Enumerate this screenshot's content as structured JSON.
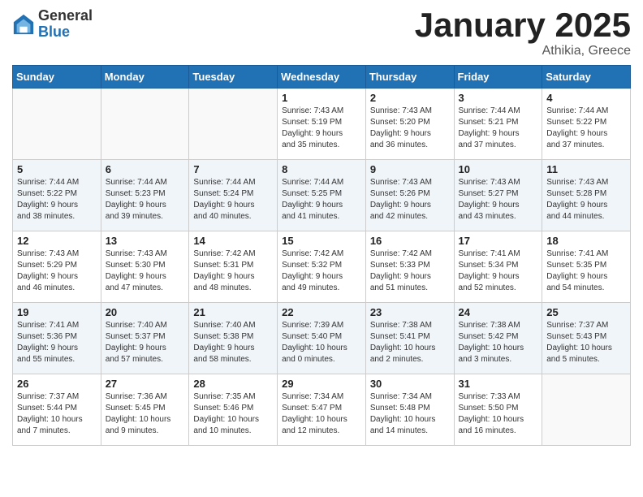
{
  "logo": {
    "general": "General",
    "blue": "Blue"
  },
  "header": {
    "title": "January 2025",
    "subtitle": "Athikia, Greece"
  },
  "weekdays": [
    "Sunday",
    "Monday",
    "Tuesday",
    "Wednesday",
    "Thursday",
    "Friday",
    "Saturday"
  ],
  "weeks": [
    [
      {
        "day": "",
        "info": ""
      },
      {
        "day": "",
        "info": ""
      },
      {
        "day": "",
        "info": ""
      },
      {
        "day": "1",
        "info": "Sunrise: 7:43 AM\nSunset: 5:19 PM\nDaylight: 9 hours\nand 35 minutes."
      },
      {
        "day": "2",
        "info": "Sunrise: 7:43 AM\nSunset: 5:20 PM\nDaylight: 9 hours\nand 36 minutes."
      },
      {
        "day": "3",
        "info": "Sunrise: 7:44 AM\nSunset: 5:21 PM\nDaylight: 9 hours\nand 37 minutes."
      },
      {
        "day": "4",
        "info": "Sunrise: 7:44 AM\nSunset: 5:22 PM\nDaylight: 9 hours\nand 37 minutes."
      }
    ],
    [
      {
        "day": "5",
        "info": "Sunrise: 7:44 AM\nSunset: 5:22 PM\nDaylight: 9 hours\nand 38 minutes."
      },
      {
        "day": "6",
        "info": "Sunrise: 7:44 AM\nSunset: 5:23 PM\nDaylight: 9 hours\nand 39 minutes."
      },
      {
        "day": "7",
        "info": "Sunrise: 7:44 AM\nSunset: 5:24 PM\nDaylight: 9 hours\nand 40 minutes."
      },
      {
        "day": "8",
        "info": "Sunrise: 7:44 AM\nSunset: 5:25 PM\nDaylight: 9 hours\nand 41 minutes."
      },
      {
        "day": "9",
        "info": "Sunrise: 7:43 AM\nSunset: 5:26 PM\nDaylight: 9 hours\nand 42 minutes."
      },
      {
        "day": "10",
        "info": "Sunrise: 7:43 AM\nSunset: 5:27 PM\nDaylight: 9 hours\nand 43 minutes."
      },
      {
        "day": "11",
        "info": "Sunrise: 7:43 AM\nSunset: 5:28 PM\nDaylight: 9 hours\nand 44 minutes."
      }
    ],
    [
      {
        "day": "12",
        "info": "Sunrise: 7:43 AM\nSunset: 5:29 PM\nDaylight: 9 hours\nand 46 minutes."
      },
      {
        "day": "13",
        "info": "Sunrise: 7:43 AM\nSunset: 5:30 PM\nDaylight: 9 hours\nand 47 minutes."
      },
      {
        "day": "14",
        "info": "Sunrise: 7:42 AM\nSunset: 5:31 PM\nDaylight: 9 hours\nand 48 minutes."
      },
      {
        "day": "15",
        "info": "Sunrise: 7:42 AM\nSunset: 5:32 PM\nDaylight: 9 hours\nand 49 minutes."
      },
      {
        "day": "16",
        "info": "Sunrise: 7:42 AM\nSunset: 5:33 PM\nDaylight: 9 hours\nand 51 minutes."
      },
      {
        "day": "17",
        "info": "Sunrise: 7:41 AM\nSunset: 5:34 PM\nDaylight: 9 hours\nand 52 minutes."
      },
      {
        "day": "18",
        "info": "Sunrise: 7:41 AM\nSunset: 5:35 PM\nDaylight: 9 hours\nand 54 minutes."
      }
    ],
    [
      {
        "day": "19",
        "info": "Sunrise: 7:41 AM\nSunset: 5:36 PM\nDaylight: 9 hours\nand 55 minutes."
      },
      {
        "day": "20",
        "info": "Sunrise: 7:40 AM\nSunset: 5:37 PM\nDaylight: 9 hours\nand 57 minutes."
      },
      {
        "day": "21",
        "info": "Sunrise: 7:40 AM\nSunset: 5:38 PM\nDaylight: 9 hours\nand 58 minutes."
      },
      {
        "day": "22",
        "info": "Sunrise: 7:39 AM\nSunset: 5:40 PM\nDaylight: 10 hours\nand 0 minutes."
      },
      {
        "day": "23",
        "info": "Sunrise: 7:38 AM\nSunset: 5:41 PM\nDaylight: 10 hours\nand 2 minutes."
      },
      {
        "day": "24",
        "info": "Sunrise: 7:38 AM\nSunset: 5:42 PM\nDaylight: 10 hours\nand 3 minutes."
      },
      {
        "day": "25",
        "info": "Sunrise: 7:37 AM\nSunset: 5:43 PM\nDaylight: 10 hours\nand 5 minutes."
      }
    ],
    [
      {
        "day": "26",
        "info": "Sunrise: 7:37 AM\nSunset: 5:44 PM\nDaylight: 10 hours\nand 7 minutes."
      },
      {
        "day": "27",
        "info": "Sunrise: 7:36 AM\nSunset: 5:45 PM\nDaylight: 10 hours\nand 9 minutes."
      },
      {
        "day": "28",
        "info": "Sunrise: 7:35 AM\nSunset: 5:46 PM\nDaylight: 10 hours\nand 10 minutes."
      },
      {
        "day": "29",
        "info": "Sunrise: 7:34 AM\nSunset: 5:47 PM\nDaylight: 10 hours\nand 12 minutes."
      },
      {
        "day": "30",
        "info": "Sunrise: 7:34 AM\nSunset: 5:48 PM\nDaylight: 10 hours\nand 14 minutes."
      },
      {
        "day": "31",
        "info": "Sunrise: 7:33 AM\nSunset: 5:50 PM\nDaylight: 10 hours\nand 16 minutes."
      },
      {
        "day": "",
        "info": ""
      }
    ]
  ]
}
